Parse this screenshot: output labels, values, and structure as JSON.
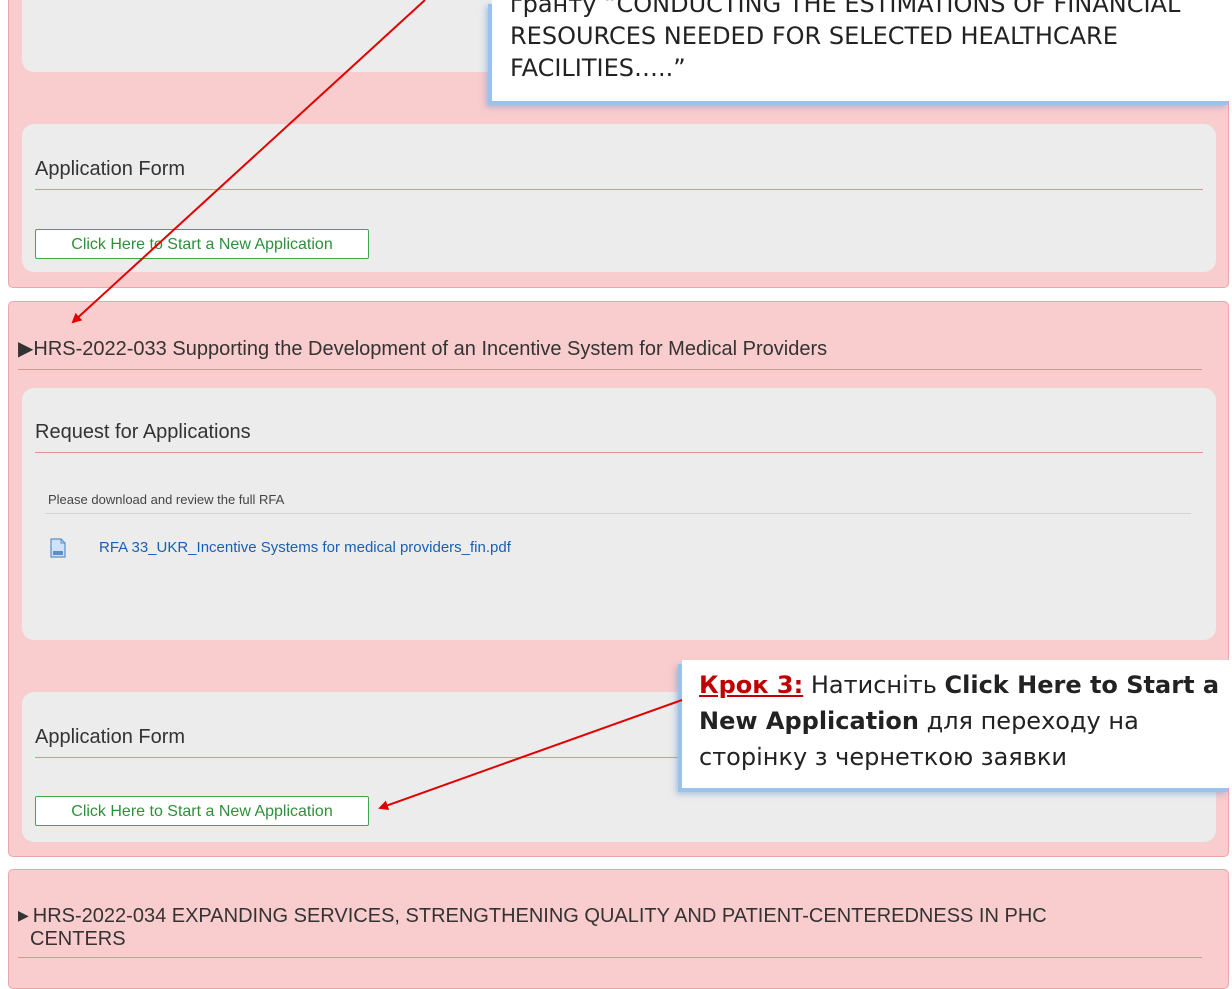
{
  "grant_1": {
    "apply_section_title": "Application Form",
    "start_button": "Click Here to Start a New Application"
  },
  "grant_2": {
    "title": "HRS-2022-033 Supporting the Development of an Incentive System for Medical Providers",
    "rfa_section_title": "Request for Applications",
    "rfa_note": "Please download and review the full RFA",
    "rfa_file": "RFA 33_UKR_Incentive Systems for medical providers_fin.pdf",
    "apply_section_title": "Application Form",
    "start_button": "Click Here to Start a New Application"
  },
  "grant_3": {
    "title_line1": "HRS-2022-034 EXPANDING SERVICES, STRENGTHENING QUALITY AND PATIENT-CENTEREDNESS IN PHC",
    "title_line2": "CENTERS"
  },
  "callout_top": {
    "line1": "гранту “CONDUCTING THE ESTIMATIONS OF FINANCIAL",
    "line2": "RESOURCES NEEDED FOR SELECTED HEALTHCARE",
    "line3": "FACILITIES…..”"
  },
  "callout_step3": {
    "step_label": "Крок 3:",
    "text_1": " Натисніть ",
    "bold_1": "Click Here to Start a New Application",
    "text_2": " для переходу на сторінку з чернеткою заявки"
  },
  "icons": {
    "caret": "triangle-right-icon",
    "file": "document-icon"
  },
  "colors": {
    "panel_pink": "#f9cccd",
    "panel_gray": "#ececec",
    "button_green": "#2f8f3a",
    "link_blue": "#1a5fb4",
    "arrow_red": "#e00000",
    "step_red": "#c00000"
  }
}
